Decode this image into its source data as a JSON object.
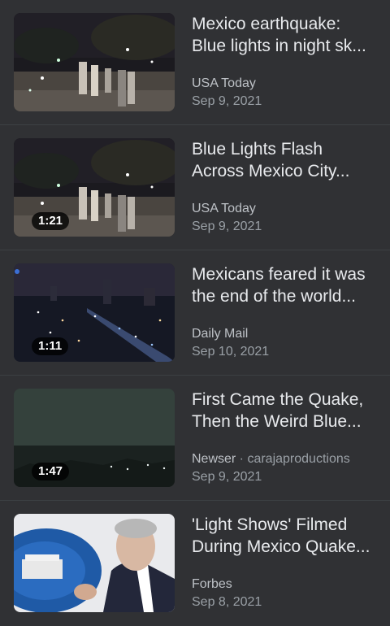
{
  "videos": [
    {
      "title_line1": "Mexico earthquake:",
      "title_line2": "Blue lights in night sk...",
      "source": "USA Today",
      "channel": "",
      "date": "Sep 9, 2021",
      "duration": ""
    },
    {
      "title_line1": "Blue Lights Flash",
      "title_line2": "Across Mexico City...",
      "source": "USA Today",
      "channel": "",
      "date": "Sep 9, 2021",
      "duration": "1:21"
    },
    {
      "title_line1": "Mexicans feared it was",
      "title_line2": "the end of the world...",
      "source": "Daily Mail",
      "channel": "",
      "date": "Sep 10, 2021",
      "duration": "1:11"
    },
    {
      "title_line1": "First Came the Quake,",
      "title_line2": "Then the Weird Blue...",
      "source": "Newser",
      "channel": " · carajaproductions",
      "date": "Sep 9, 2021",
      "duration": "1:47"
    },
    {
      "title_line1": "'Light Shows' Filmed",
      "title_line2": "During Mexico Quake...",
      "source": "Forbes",
      "channel": "",
      "date": "Sep 8, 2021",
      "duration": ""
    }
  ]
}
